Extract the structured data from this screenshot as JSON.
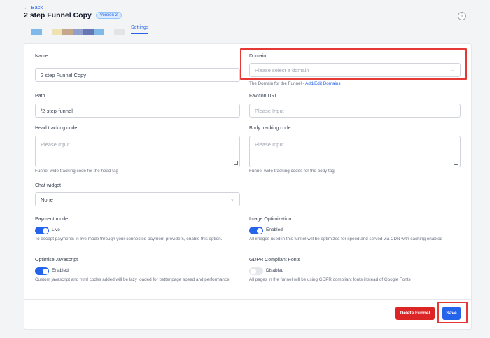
{
  "header": {
    "back_label": "Back",
    "title": "2 step Funnel Copy",
    "version_badge": "Version 2"
  },
  "tabs": {
    "swatches": [
      "#7fb9ea",
      "#efe2b2",
      "#c7a78c",
      "#8ea1cc",
      "#6676b3",
      "#7fb9ea",
      "#e2e4e8"
    ],
    "active_label": "Settings"
  },
  "form": {
    "name": {
      "label": "Name",
      "value": "2 step Funnel Copy"
    },
    "domain": {
      "label": "Domain",
      "placeholder": "Please select a domain",
      "help_prefix": "The Domain for the Funnel - ",
      "help_link": "Add/Edit Domains"
    },
    "path": {
      "label": "Path",
      "value": "/2-step-funnel"
    },
    "favicon": {
      "label": "Favicon URL",
      "placeholder": "Please Input"
    },
    "head_tracking": {
      "label": "Head tracking code",
      "placeholder": "Please Input",
      "help": "Funnel wide tracking code for the head tag"
    },
    "body_tracking": {
      "label": "Body tracking code",
      "placeholder": "Please Input",
      "help": "Funnel wide tracking codes for the body tag"
    },
    "chat_widget": {
      "label": "Chat widget",
      "value": "None"
    },
    "payment_mode": {
      "label": "Payment mode",
      "state": "Live",
      "help": "To accept payments in live mode through your connected payment providers, enable this option."
    },
    "image_optimization": {
      "label": "Image Optimization",
      "state": "Enabled",
      "help": "All images used in this funnel will be optimized for speed and served via CDN with caching enabled"
    },
    "optimise_js": {
      "label": "Optimise Javascript",
      "state": "Enabled",
      "help": "Custom javascript and html codes added will be lazy loaded for better page speed and performance"
    },
    "gdpr_fonts": {
      "label": "GDPR Compliant Fonts",
      "state": "Disabled",
      "help": "All pages in the funnel will be using GDPR compliant fonts instead of Google Fonts"
    }
  },
  "actions": {
    "delete_label": "Delete Funnel",
    "save_label": "Save"
  },
  "colors": {
    "accent": "#2563eb",
    "danger": "#dc2626",
    "highlight": "#e53935"
  }
}
